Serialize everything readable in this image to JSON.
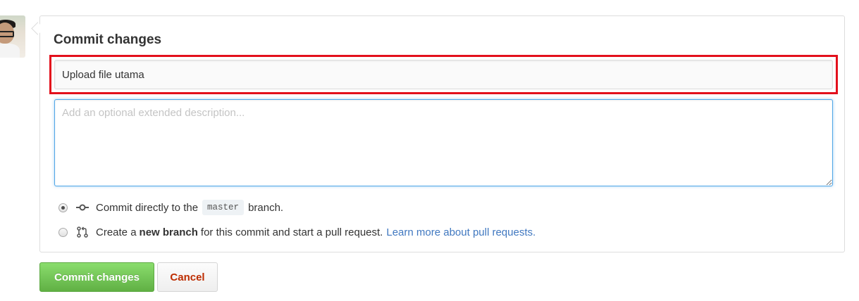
{
  "avatar": {
    "icon": "user-avatar"
  },
  "commit_form": {
    "title": "Commit changes",
    "summary_value": "Upload file utama",
    "description_placeholder": "Add an optional extended description...",
    "options": {
      "direct": {
        "selected": true,
        "icon": "git-commit-icon",
        "text_before": "Commit directly to the",
        "branch_name": "master",
        "text_after": "branch."
      },
      "new_branch": {
        "selected": false,
        "icon": "git-pull-request-icon",
        "text_before": "Create a",
        "bold_text": "new branch",
        "text_after": "for this commit and start a pull request.",
        "link_text": "Learn more about pull requests."
      }
    }
  },
  "buttons": {
    "commit_label": "Commit changes",
    "cancel_label": "Cancel"
  },
  "colors": {
    "highlight_border": "#e3101c",
    "commit_button": "#60b044",
    "cancel_text": "#bd2c00",
    "link": "#4078c0",
    "focus_border": "#51a7e8"
  }
}
